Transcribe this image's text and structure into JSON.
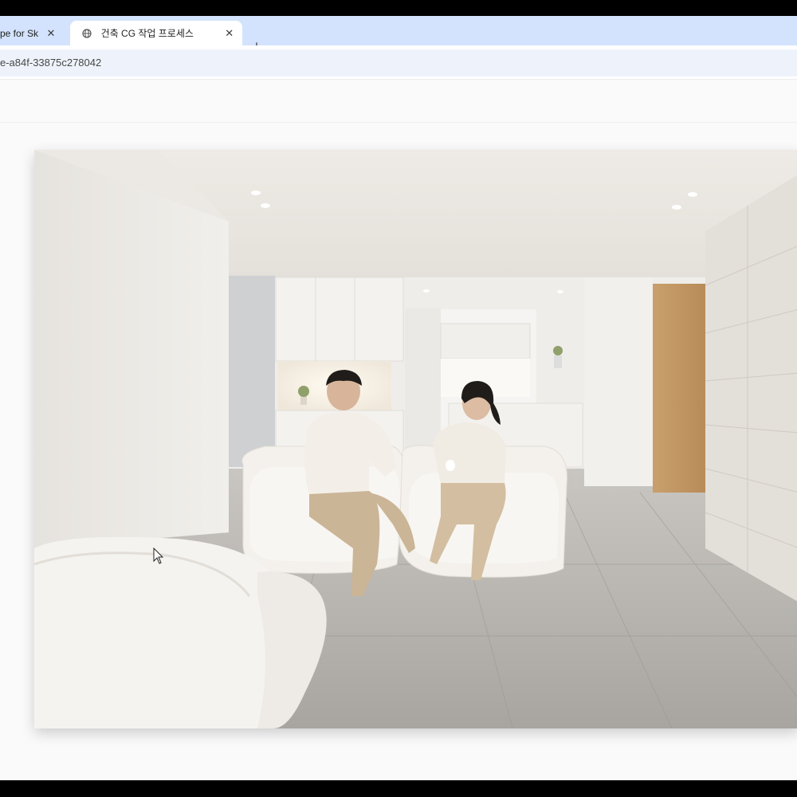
{
  "browser": {
    "tabs": [
      {
        "label": "pe for Sket"
      },
      {
        "label": "건축 CG 작업 프로세스"
      }
    ],
    "new_tab_label": "+",
    "close_label": "✕",
    "address": "e-a84f-33875c278042"
  },
  "image": {
    "alt": "Interior render: two people seated on white boucle armchairs in a bright living room"
  },
  "colors": {
    "tab_strip": "#d3e3fd",
    "address_field": "#eef3fb",
    "page_background": "#fafafa"
  }
}
